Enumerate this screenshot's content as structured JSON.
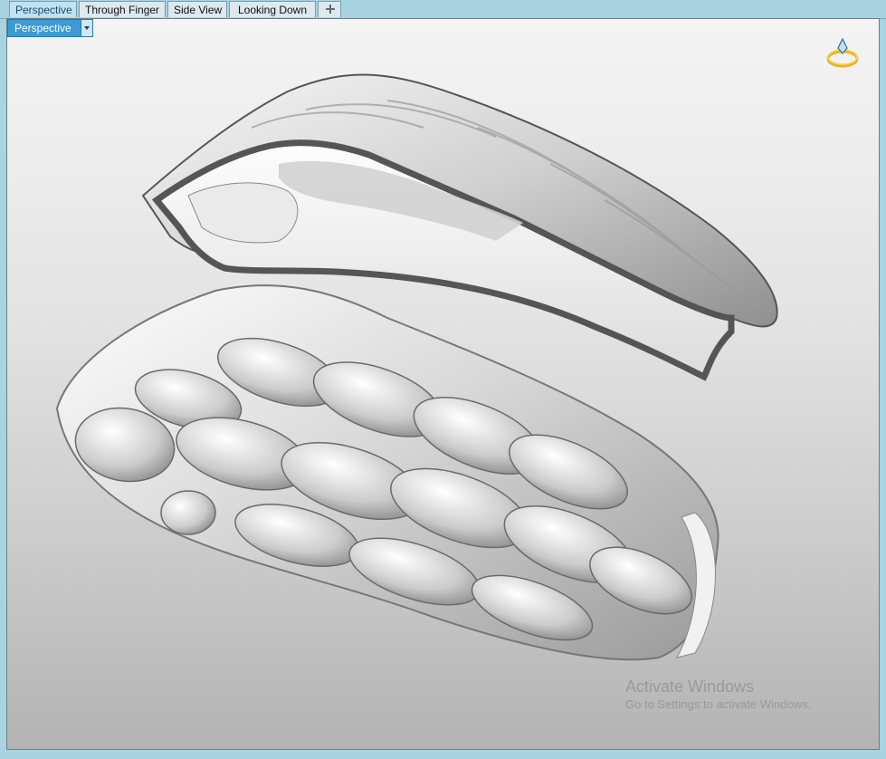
{
  "tabs": [
    {
      "label": "Perspective",
      "active": true
    },
    {
      "label": "Through Finger",
      "active": false
    },
    {
      "label": "Side View",
      "active": false
    },
    {
      "label": "Looking Down",
      "active": false
    }
  ],
  "add_tab_icon": "plus-icon",
  "viewport": {
    "label": "Perspective",
    "dropdown_icon": "chevron-down-icon",
    "gizmo_icon": "ring-gizmo-icon"
  },
  "watermark": {
    "title": "Activate Windows",
    "subtitle": "Go to Settings to activate Windows."
  },
  "colors": {
    "tab_background": "#a9d3e1",
    "active_tab": "#bfe3f3",
    "viewport_label": "#3a9bd6",
    "gizmo": "#e8b520"
  }
}
